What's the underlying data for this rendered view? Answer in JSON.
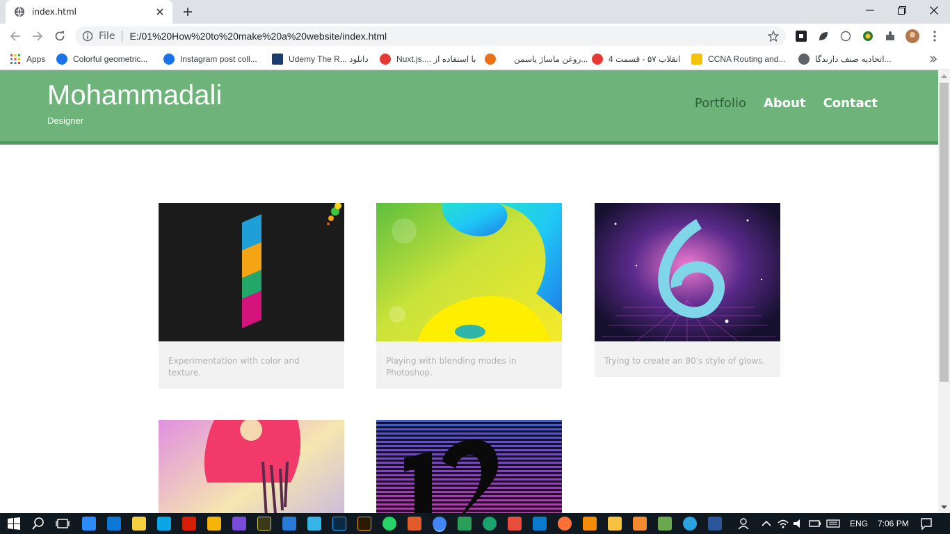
{
  "browser": {
    "tab_title": "index.html",
    "file_label": "File",
    "url": "E:/01%20How%20to%20make%20a%20website/index.html",
    "bookmarks": [
      {
        "label": "Apps",
        "color": "#ea4335"
      },
      {
        "label": "Colorful geometric...",
        "color": "#1a73e8"
      },
      {
        "label": "Instagram post coll...",
        "color": "#1a73e8"
      },
      {
        "label": "Udemy The R... دانلود",
        "color": "#1d3c6e"
      },
      {
        "label": "Nuxt.js.... با استفاده از",
        "color": "#e53935"
      },
      {
        "label": "روغن ماساژ یاسمن...",
        "color": "#e8711a"
      },
      {
        "label": "انقلاب ۵۷ - قسمت 4",
        "color": "#e53935"
      },
      {
        "label": "CCNA Routing and...",
        "color": "#f4c20d"
      },
      {
        "label": "اتحادیه صنف دارندگا...",
        "color": "#5f6368"
      }
    ]
  },
  "site": {
    "title": "Mohammadali",
    "subtitle": "Designer",
    "nav": [
      {
        "label": "Portfolio"
      },
      {
        "label": "About"
      },
      {
        "label": "Contact"
      }
    ],
    "colors": {
      "header": "#6db37a",
      "header_border": "#4f9a5f",
      "nav_active": "#2f5f3b"
    }
  },
  "portfolio": [
    {
      "caption": "Experimentation with color and texture.",
      "art": "number-1-dark"
    },
    {
      "caption": "Playing with blending modes in Photoshop.",
      "art": "number-2-gradient"
    },
    {
      "caption": "Trying to create an 80's style of glows.",
      "art": "number-6-neon"
    },
    {
      "caption": "",
      "art": "number-9-watercolor"
    },
    {
      "caption": "",
      "art": "number-12-stripes"
    }
  ],
  "taskbar": {
    "language": "ENG",
    "time": "7:06 PM"
  }
}
